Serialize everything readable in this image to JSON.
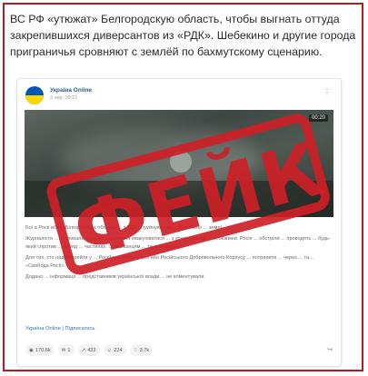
{
  "article": {
    "headline": "ВС РФ «утюжат» Белгородскую область, чтобы выгнать оттуда закрепившихся диверсантов из «РДК». Шебекино и другие города приграничья сровняют с землёй по бахмутскому сценарию."
  },
  "post": {
    "channel": "Україна Online",
    "time": "3 чер, 09:21",
    "video_duration": "00:20",
    "paragraphs": [
      "Бої в Росії вбогі. Білгородська область ... з РДК ... руйнування ... Шебекино ... землі.",
      "Журналісти ... закликали місцеве населення евакуюватися ... з урахуванням ... небезпеки. Росія ... обстріли ... проводять ... будь-який спротив ... поряд ... частинах ... мешканцям ... та співаксою.",
      "Для тих, хто надо порейти у ... Російську армію Росії або Російського Добровольчого Корпусу ... потрапити ... через ... та ... «Свобода Росії».",
      "Додано ... інформації ... представників української влади ... не коментували."
    ],
    "footer_link": "Україна Online | Підписатись",
    "stats": [
      {
        "icon": "eye-icon",
        "value": "170.6k"
      },
      {
        "icon": "comment-icon",
        "value": "1"
      },
      {
        "icon": "repost-icon",
        "value": "433"
      },
      {
        "icon": "reaction-icon",
        "value": "224"
      },
      {
        "icon": "like-icon",
        "value": "3.7k"
      }
    ]
  },
  "stamp": {
    "text": "ФЕЙК",
    "color": "#cd1f26"
  }
}
